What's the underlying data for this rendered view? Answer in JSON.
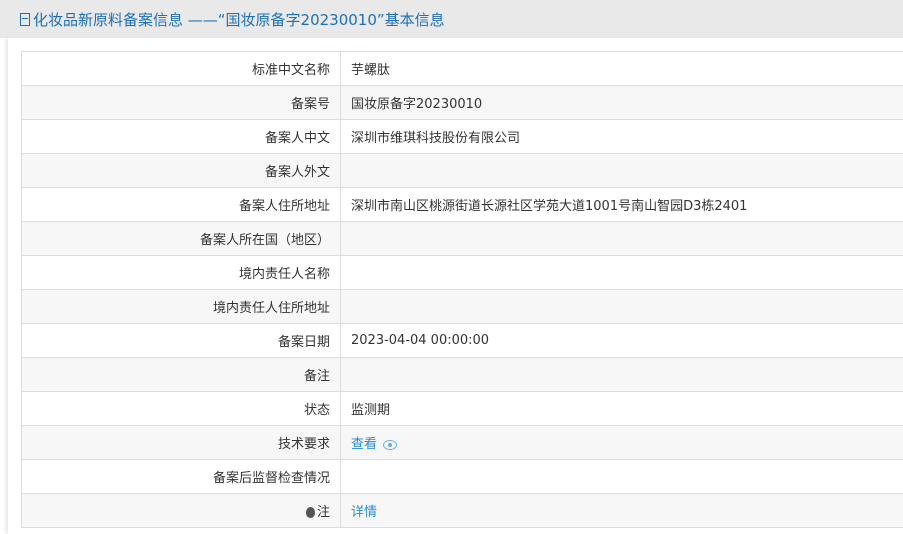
{
  "header": {
    "title": "化妆品新原料备案信息 ——“国妆原备字20230010”基本信息"
  },
  "rows": [
    {
      "label": "标准中文名称",
      "value": "芋螺肽"
    },
    {
      "label": "备案号",
      "value": "国妆原备字20230010"
    },
    {
      "label": "备案人中文",
      "value": "深圳市维琪科技股份有限公司"
    },
    {
      "label": "备案人外文",
      "value": ""
    },
    {
      "label": "备案人住所地址",
      "value": "深圳市南山区桃源街道长源社区学苑大道1001号南山智园D3栋2401"
    },
    {
      "label": "备案人所在国（地区）",
      "value": ""
    },
    {
      "label": "境内责任人名称",
      "value": ""
    },
    {
      "label": "境内责任人住所地址",
      "value": ""
    },
    {
      "label": "备案日期",
      "value": "2023-04-04 00:00:00"
    },
    {
      "label": "备注",
      "value": ""
    },
    {
      "label": "状态",
      "value": "监测期"
    },
    {
      "label": "技术要求",
      "value": "查看"
    },
    {
      "label": "备案后监督检查情况",
      "value": ""
    },
    {
      "label": "注",
      "value": "详情"
    }
  ]
}
